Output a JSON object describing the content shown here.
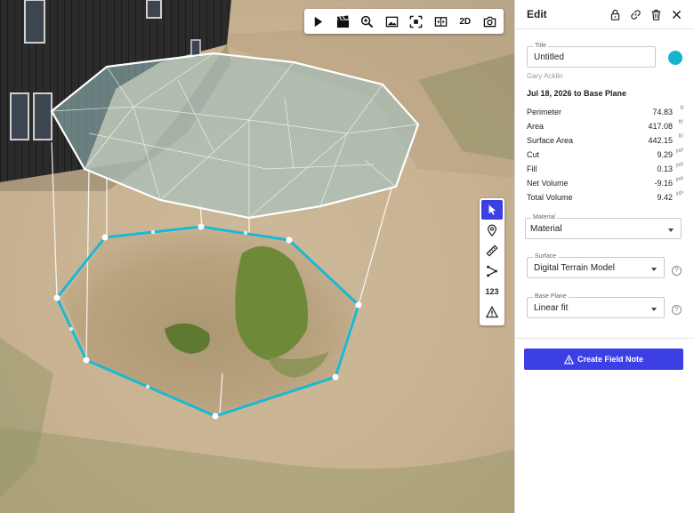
{
  "toolbar": {
    "items": [
      {
        "icon": "play-icon"
      },
      {
        "icon": "clapperboard-icon"
      },
      {
        "icon": "zoom-in-icon"
      },
      {
        "icon": "image-icon"
      },
      {
        "icon": "fit-extent-icon"
      },
      {
        "icon": "compare-icon"
      },
      {
        "icon": "view-mode-2d",
        "label": "2D"
      },
      {
        "icon": "camera-icon"
      }
    ]
  },
  "side_tools": [
    {
      "icon": "pointer-icon",
      "active": true
    },
    {
      "icon": "map-pin-icon"
    },
    {
      "icon": "ruler-icon"
    },
    {
      "icon": "polyline-icon"
    },
    {
      "icon": "label-123",
      "label": "123"
    },
    {
      "icon": "warning-icon"
    }
  ],
  "panel": {
    "title": "Edit",
    "header_icons": [
      "lock-icon",
      "link-icon",
      "trash-icon",
      "close-icon"
    ],
    "title_field": {
      "label": "Title",
      "value": "Untitled"
    },
    "color": "#17b3cf",
    "author": "Gary Acklin",
    "date_line": "Jul 18, 2026 to Base Plane",
    "metrics": [
      {
        "label": "Perimeter",
        "value": "74.83",
        "unit": "ft"
      },
      {
        "label": "Area",
        "value": "417.08",
        "unit": "ft²"
      },
      {
        "label": "Surface Area",
        "value": "442.15",
        "unit": "ft²"
      },
      {
        "label": "Cut",
        "value": "9.29",
        "unit": "yd³"
      },
      {
        "label": "Fill",
        "value": "0.13",
        "unit": "yd³"
      },
      {
        "label": "Net Volume",
        "value": "-9.16",
        "unit": "yd³"
      },
      {
        "label": "Total Volume",
        "value": "9.42",
        "unit": "yd³"
      }
    ],
    "material": {
      "label": "Material",
      "value": "Material"
    },
    "surface": {
      "label": "Surface",
      "value": "Digital Terrain Model",
      "help": "?"
    },
    "base_plane": {
      "label": "Base Plane",
      "value": "Linear fit",
      "help": "?"
    },
    "field_note_button": "Create Field Note"
  },
  "colors": {
    "accent": "#3b3fe4",
    "measure_outline": "#19b9d4",
    "sand": "#cbb697",
    "grass": "#6f8a3a",
    "building": "#2a2a2a"
  }
}
